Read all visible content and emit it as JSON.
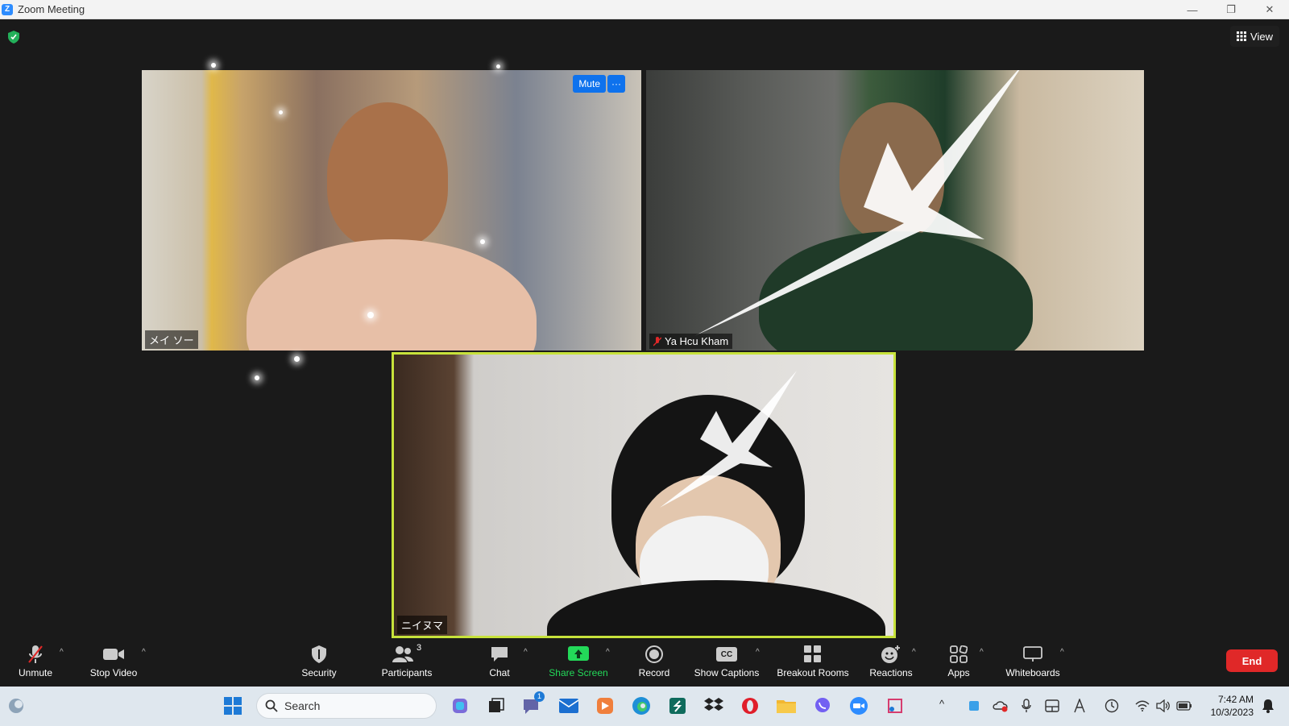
{
  "window": {
    "title": "Zoom Meeting",
    "logo_letter": "Z",
    "minimize_icon": "—",
    "restore_icon": "❐",
    "close_icon": "✕"
  },
  "meeting": {
    "view_label": "View",
    "participants": [
      {
        "name": "メイ ソー",
        "muted": false
      },
      {
        "name": "Ya Hcu Kham",
        "muted": true
      },
      {
        "name": "ニイヌマ",
        "muted": false,
        "active_speaker": true
      }
    ],
    "tile_mute_label": "Mute",
    "tile_more_label": "···"
  },
  "toolbar": {
    "unmute": "Unmute",
    "stop_video": "Stop Video",
    "security": "Security",
    "participants": "Participants",
    "participants_count": "3",
    "chat": "Chat",
    "share_screen": "Share Screen",
    "record": "Record",
    "show_captions": "Show Captions",
    "captions_icon_text": "CC",
    "breakout_rooms": "Breakout Rooms",
    "reactions": "Reactions",
    "apps": "Apps",
    "whiteboards": "Whiteboards",
    "end": "End"
  },
  "taskbar": {
    "search_placeholder": "Search",
    "chat_badge": "1",
    "time": "7:42 AM",
    "date": "10/3/2023"
  }
}
